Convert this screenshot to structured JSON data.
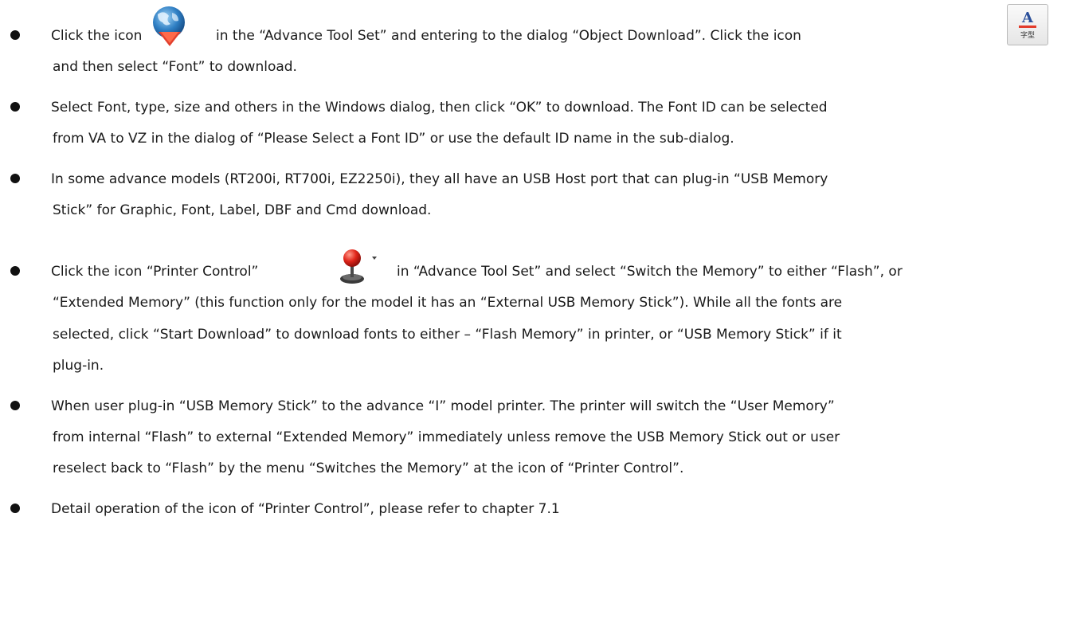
{
  "bullets": [
    {
      "lines": [
        {
          "part1": "Click the icon",
          "part2": "in the “Advance Tool Set” and entering to the dialog “Object Download”. Click the icon"
        },
        "and then select “Font” to download."
      ],
      "icons": [
        "download-globe-icon",
        "font-glyph-icon"
      ]
    },
    {
      "lines": [
        "Select Font, type, size and others in the Windows dialog, then click “OK” to download. The Font ID can be selected",
        "from VA to VZ in the dialog of “Please Select a Font ID” or use the default ID name in the sub-dialog."
      ]
    },
    {
      "lines": [
        "In some advance models (RT200i, RT700i, EZ2250i), they all have an USB Host port that can plug-in “USB Memory",
        "Stick” for Graphic, Font, Label, DBF and Cmd download."
      ]
    },
    {
      "lines": [
        {
          "part1": "Click the icon “Printer Control”",
          "part2": "in “Advance Tool Set” and select “Switch the Memory” to either “Flash”, or"
        },
        "“Extended Memory” (this function only for the model it has an “External USB Memory Stick”). While all the fonts are",
        "selected, click “Start Download” to download fonts to either – “Flash Memory” in printer, or “USB Memory Stick” if it",
        "plug-in."
      ],
      "icons": [
        "printer-control-joystick-icon"
      ]
    },
    {
      "lines": [
        "When user plug-in “USB Memory Stick” to the advance “I” model printer. The printer will switch the “User Memory”",
        "from internal “Flash” to external “Extended Memory” immediately unless remove the USB Memory Stick out or user",
        "reselect back to “Flash” by the menu “Switches the Memory” at the icon of “Printer Control”."
      ]
    },
    {
      "lines": [
        "Detail operation of the icon of “Printer Control”, please refer to chapter 7.1"
      ]
    }
  ],
  "font_icon_glyph": {
    "main": "A",
    "sub": "字型"
  }
}
